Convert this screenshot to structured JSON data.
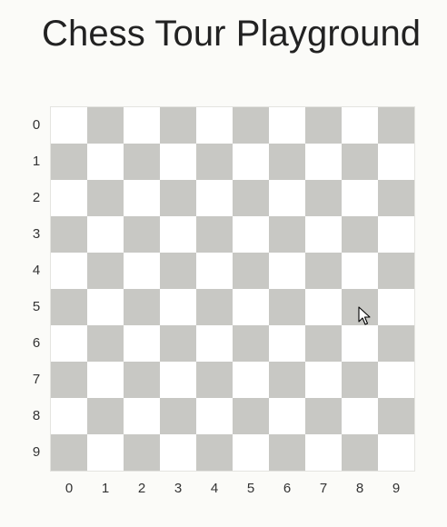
{
  "page": {
    "title": "Chess Tour Playground"
  },
  "board": {
    "rows": 10,
    "cols": 10,
    "row_labels": [
      "0",
      "1",
      "2",
      "3",
      "4",
      "5",
      "6",
      "7",
      "8",
      "9"
    ],
    "col_labels": [
      "0",
      "1",
      "2",
      "3",
      "4",
      "5",
      "6",
      "7",
      "8",
      "9"
    ],
    "light_color": "#ffffff",
    "dark_color": "#c8c8c4"
  },
  "cursor": {
    "icon": "mouse-pointer-icon"
  }
}
